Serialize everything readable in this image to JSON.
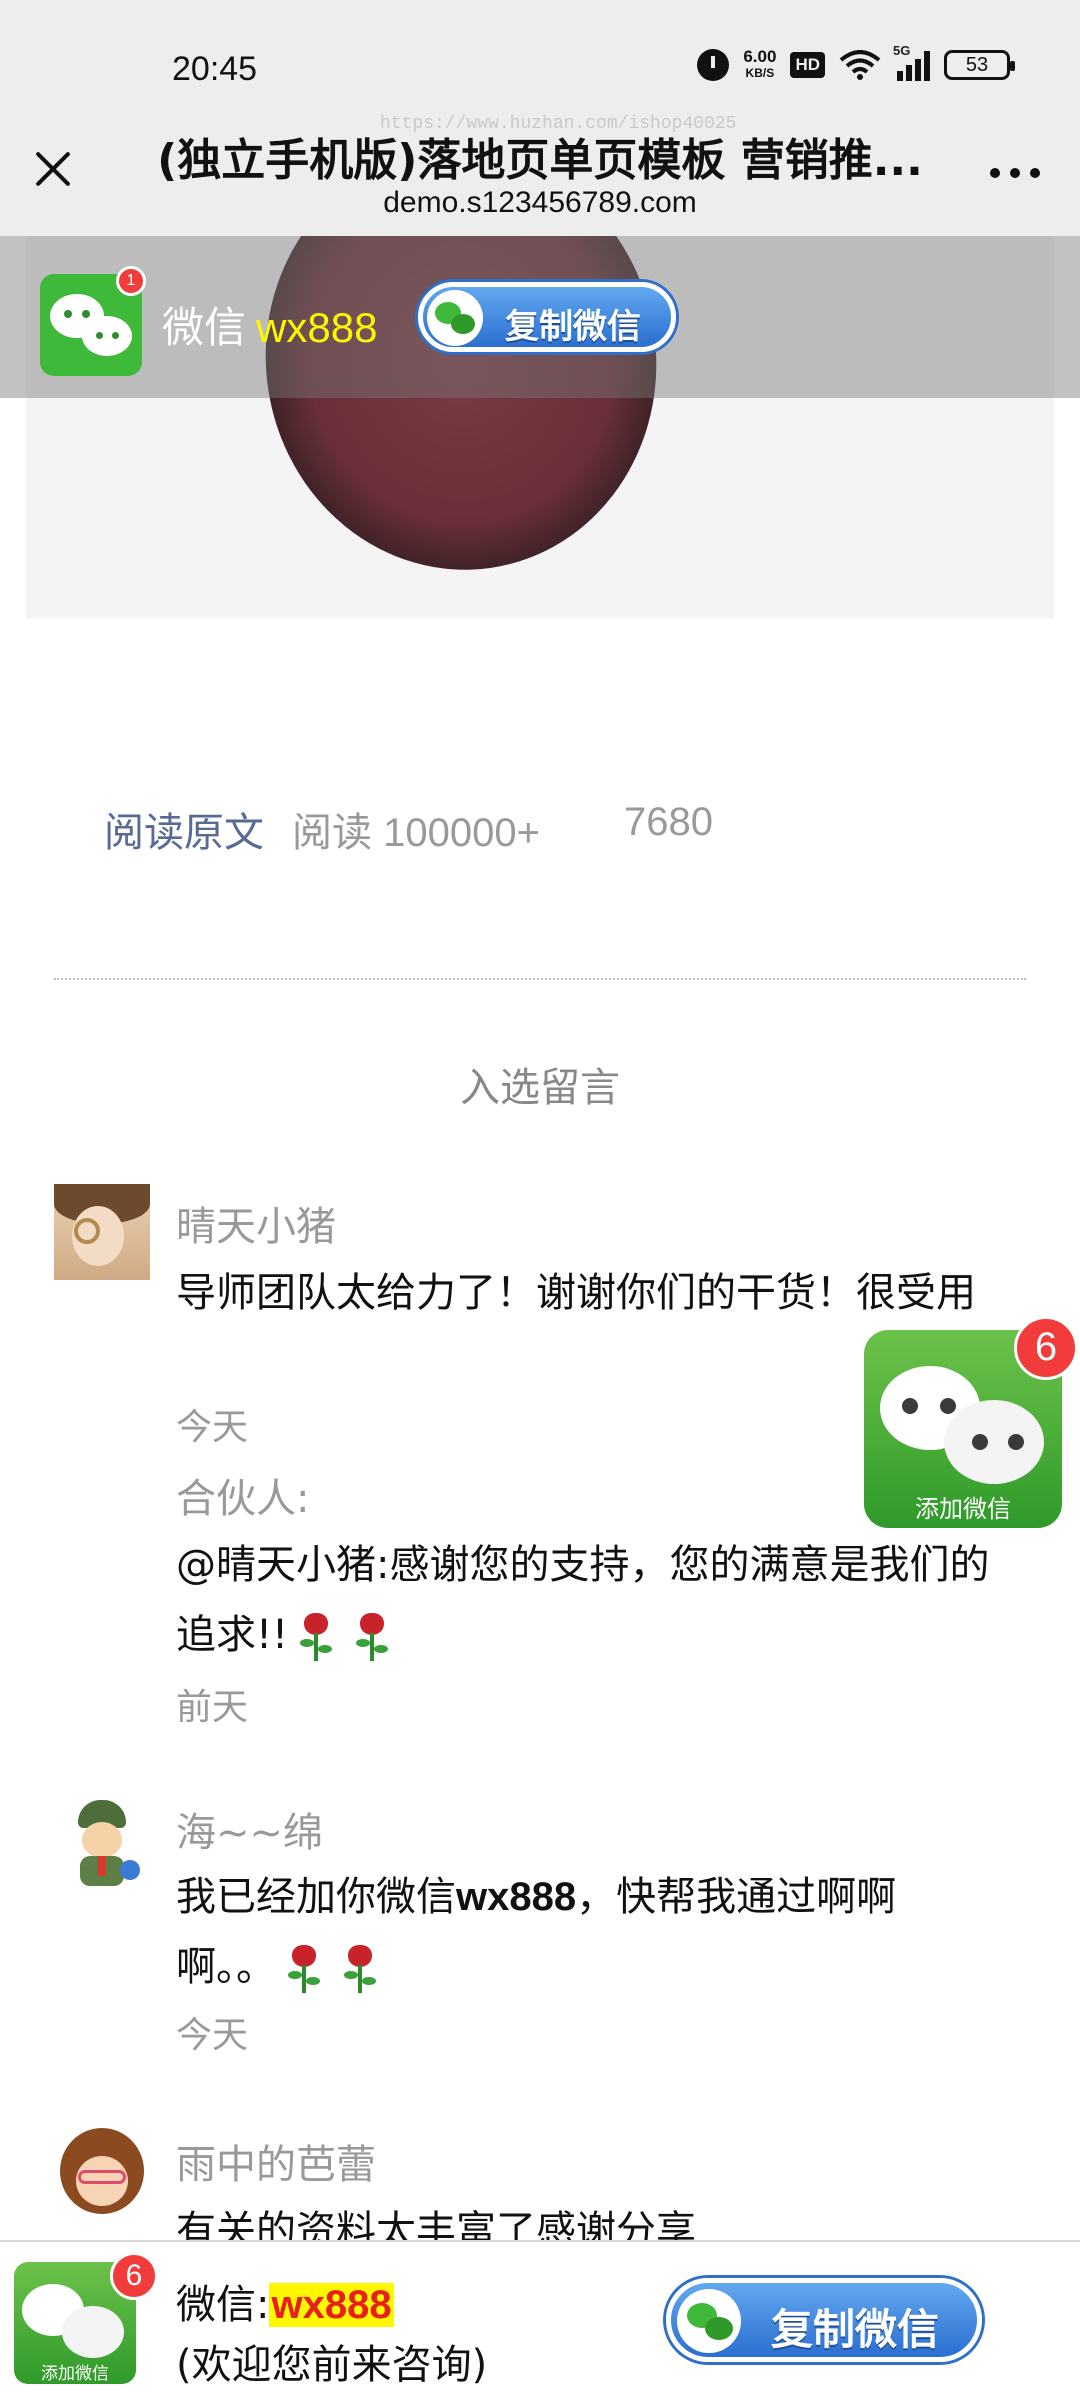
{
  "status_bar": {
    "time": "20:45",
    "net_speed_value": "6.00",
    "net_speed_unit": "KB/S",
    "hd_label": "HD",
    "signal_tag": "5G",
    "battery_level": "53"
  },
  "browser": {
    "title": "(独立手机版)落地页单页模板 营销推...",
    "url": "demo.s123456789.com",
    "watermark": "https://www.huzhan.com/ishop40025"
  },
  "sticky_bar": {
    "wechat_label": "微信",
    "wechat_id": "wx888",
    "badge_count": "1",
    "copy_button": "复制微信"
  },
  "stats": {
    "read_original": "阅读原文",
    "read_label": "阅读",
    "read_count": "100000+",
    "like_count": "7680"
  },
  "comments_title": "入选留言",
  "comments": [
    {
      "name": "晴天小猪",
      "text": "导师团队太给力了！谢谢你们的干货！很受用",
      "time": "今天",
      "reply_label": "合伙人:",
      "reply_text": "@晴天小猪:感谢您的支持，您的满意是我们的追求!!",
      "reply_time": "前天"
    },
    {
      "name": "海~~绵",
      "text_before": "我已经加你微信",
      "text_id": "wx888",
      "text_after": "，快帮我通过啊啊啊。。",
      "time": "今天"
    },
    {
      "name": "雨中的芭蕾",
      "text": "有关的资料太丰富了感谢分享"
    }
  ],
  "float_widget": {
    "badge_count": "6",
    "label": "添加微信"
  },
  "bottom_bar": {
    "badge_count": "6",
    "icon_label": "添加微信",
    "wechat_prefix": "微信:",
    "wechat_id": "wx888",
    "tagline": "(欢迎您前来咨询)",
    "copy_button": "复制微信"
  },
  "colors": {
    "wechat_green": "#3fb93a",
    "link_blue": "#576b95",
    "highlight_yellow": "#fff700",
    "badge_red": "#f23c3c",
    "button_blue": "#2b6fd0"
  }
}
